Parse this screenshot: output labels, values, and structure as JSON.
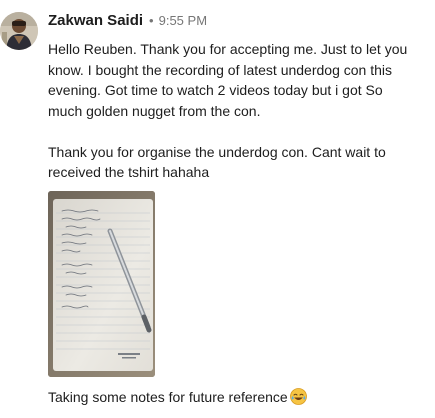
{
  "message": {
    "sender": "Zakwan Saidi",
    "separator": "•",
    "time": "9:55 PM",
    "paragraphs": [
      "Hello Reuben. Thank you for accepting me. Just to let you know. I bought the recording of latest underdog con this evening. Got time to watch 2 videos today but i got So much golden nugget from the con.",
      "Thank you for organise the underdog con. Cant wait to received the tshirt hahaha"
    ],
    "caption": "Taking some notes for future reference",
    "caption_emoji": "joy-emoji-icon"
  }
}
